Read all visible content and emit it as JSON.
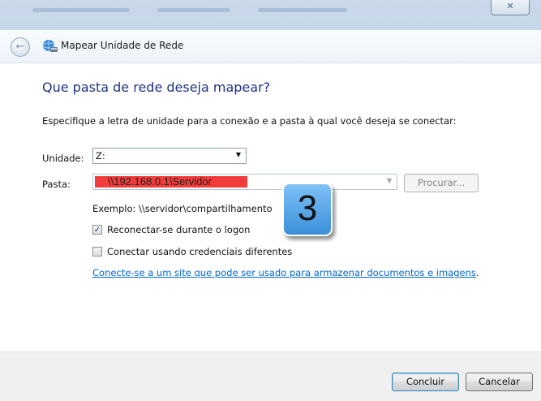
{
  "titlebar": {
    "title": "Mapear Unidade de Rede",
    "close_glyph": "✕"
  },
  "main": {
    "heading": "Que pasta de rede deseja mapear?",
    "instruction": "Especifique a letra de unidade para a conexão e a pasta à qual você deseja se conectar:",
    "drive_label": "Unidade:",
    "drive_value": "Z:",
    "folder_label": "Pasta:",
    "folder_value": "\\\\192.168.0.1\\Servidor",
    "browse_label": "Procurar...",
    "example": "Exemplo: \\\\servidor\\compartilhamento",
    "reconnect_label": "Reconectar-se durante o logon",
    "reconnect_checked": true,
    "credentials_label": "Conectar usando credenciais diferentes",
    "credentials_checked": false,
    "link": "Conecte-se a um site que pode ser usado para armazenar documentos e imagens",
    "link_suffix": ".",
    "step_badge": "3"
  },
  "footer": {
    "finish_label": "Concluir",
    "cancel_label": "Cancelar"
  },
  "icons": {
    "back": "back-arrow-icon",
    "app": "network-drive-icon",
    "combo_arrow": "dropdown-arrow-icon",
    "checkmark": "checkmark-icon"
  },
  "colors": {
    "heading": "#1e3287",
    "link": "#0066cc",
    "highlight": "#f23b3b",
    "badge": "#3a8fd9"
  }
}
